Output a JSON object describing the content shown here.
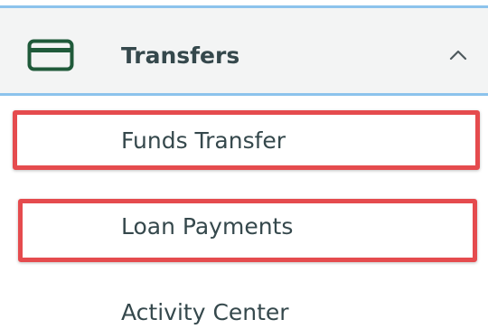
{
  "menu": {
    "section": {
      "label": "Transfers",
      "icon": "credit-card-icon",
      "expanded": true,
      "chevron_icon": "chevron-up-icon",
      "accent_color": "#8cc3ec"
    },
    "items": [
      {
        "label": "Funds Transfer",
        "highlighted": true
      },
      {
        "label": "Loan Payments",
        "highlighted": true
      },
      {
        "label": "Activity Center",
        "highlighted": false
      }
    ],
    "highlight_color": "#e54b4e"
  }
}
